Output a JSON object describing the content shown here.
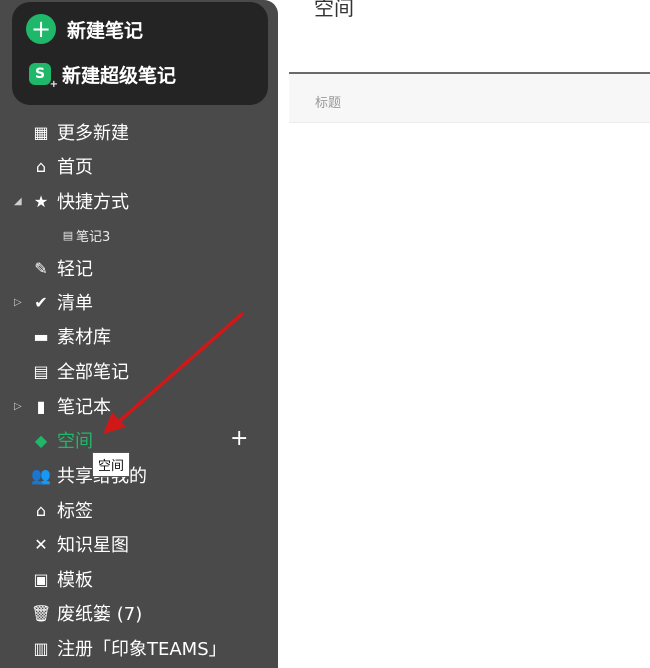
{
  "new_box": {
    "new_note": "新建笔记",
    "new_super_note": "新建超级笔记",
    "super_icon_letter": "S"
  },
  "nav": {
    "more_new": "更多新建",
    "home": "首页",
    "shortcuts": "快捷方式",
    "shortcut_note": "笔记3",
    "quick_note": "轻记",
    "checklist": "清单",
    "materials": "素材库",
    "all_notes": "全部笔记",
    "notebooks": "笔记本",
    "space": "空间",
    "shared_with_me": "共享给我的",
    "tags": "标签",
    "knowledge_graph": "知识星图",
    "templates": "模板",
    "trash": "废纸篓",
    "trash_count": "(7)",
    "register": "注册「印象TEAMS」"
  },
  "tooltip": "空间",
  "main": {
    "title": "空间",
    "column_title": "标题"
  },
  "colors": {
    "sidebar_bg": "#4a4a4a",
    "new_box_bg": "#242424",
    "accent_green": "#1fb86b",
    "annotation_arrow": "#d01818"
  }
}
